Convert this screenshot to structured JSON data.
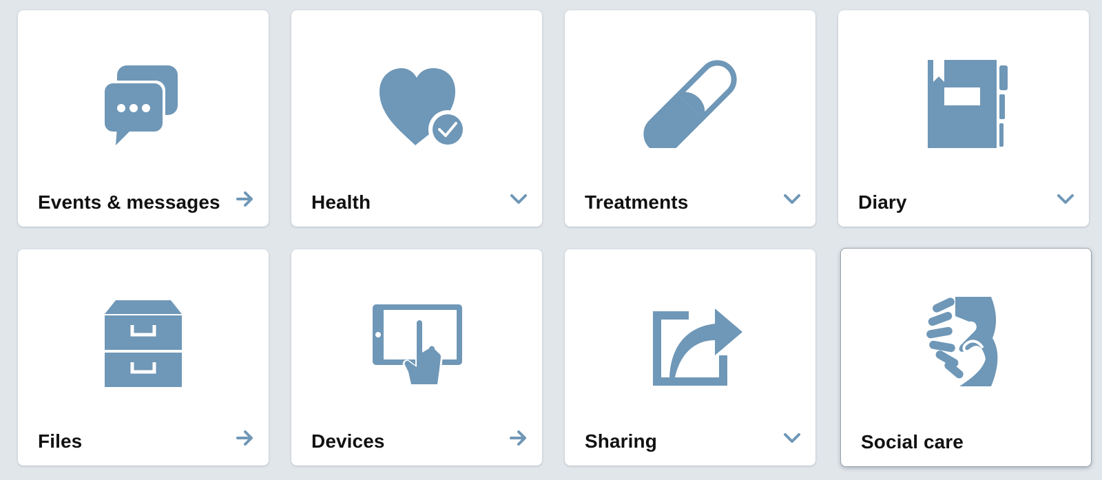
{
  "colors": {
    "background": "#e1e6ea",
    "tile": "#ffffff",
    "icon": "#6f97b7",
    "text": "#111111"
  },
  "tiles": [
    {
      "label": "Events & messages",
      "icon": "chat-bubbles-icon",
      "action": "arrow-right-icon"
    },
    {
      "label": "Health",
      "icon": "heart-check-icon",
      "action": "chevron-down-icon"
    },
    {
      "label": "Treatments",
      "icon": "pill-capsule-icon",
      "action": "chevron-down-icon"
    },
    {
      "label": "Diary",
      "icon": "diary-book-icon",
      "action": "chevron-down-icon"
    },
    {
      "label": "Files",
      "icon": "filing-cabinet-icon",
      "action": "arrow-right-icon"
    },
    {
      "label": "Devices",
      "icon": "tablet-touch-icon",
      "action": "arrow-right-icon"
    },
    {
      "label": "Sharing",
      "icon": "share-arrow-icon",
      "action": "chevron-down-icon"
    },
    {
      "label": "Social care",
      "icon": "handshake-icon",
      "action": ""
    }
  ]
}
